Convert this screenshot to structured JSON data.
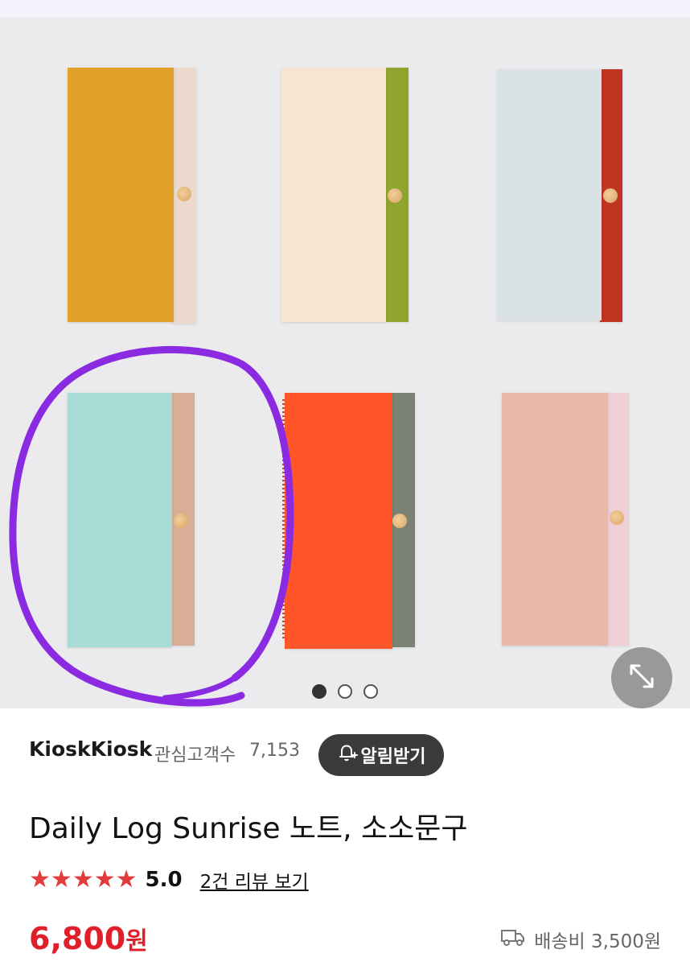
{
  "gallery": {
    "notebooks": [
      {
        "cover": "#e1a12a",
        "spine": "#ead9cc",
        "dot": true
      },
      {
        "cover": "#f6e5cf",
        "spine": "#8fa52d",
        "dot": true
      },
      {
        "cover": "#d9e1e5",
        "spine": "#bf3522",
        "dot": true
      },
      {
        "cover": "#a8dbd6",
        "spine": "#d8ae97",
        "dot": true
      },
      {
        "cover": "#ff5529",
        "spine": "#7a8373",
        "dot": true
      },
      {
        "cover": "#eab8a6",
        "spine": "#f0cfd7",
        "dot": true
      }
    ],
    "pagination": {
      "total": 3,
      "active": 0
    },
    "expand_icon": "expand-icon",
    "annotation_color": "#8a2be2"
  },
  "seller": {
    "name": "KioskKiosk",
    "fans_label": "관심고객수",
    "fans_count": "7,153",
    "alarm_label": "알림받기",
    "alarm_icon": "bell-plus-icon"
  },
  "product": {
    "title": "Daily Log Sunrise 노트, 소소문구",
    "rating": "5.0",
    "stars": 5,
    "review_link": "2건 리뷰 보기",
    "price": "6,800",
    "currency": "원",
    "shipping": "배송비 3,500원",
    "shipping_icon": "truck-icon",
    "accent_color": "#e01f2a"
  }
}
